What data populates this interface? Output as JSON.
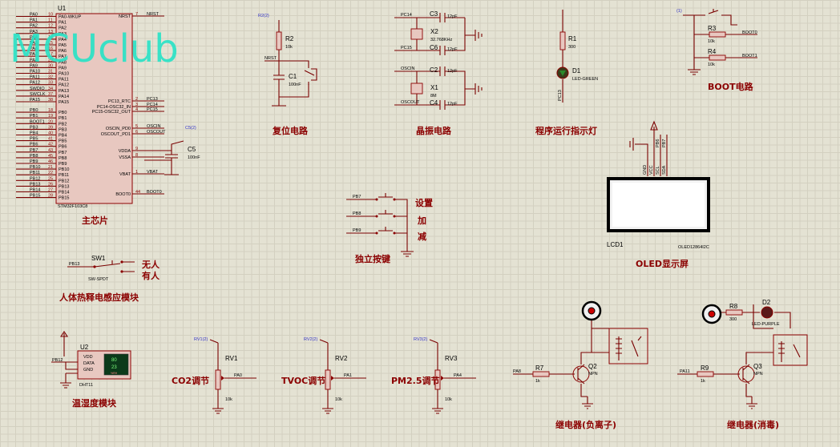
{
  "watermark": "MCUclub",
  "chip": {
    "ref": "U1",
    "part": "STM32F103C8",
    "section": "主芯片",
    "left_pins": [
      {
        "name": "PA0",
        "num": "10"
      },
      {
        "name": "PA1",
        "num": "11"
      },
      {
        "name": "PA2",
        "num": "12"
      },
      {
        "name": "PA3",
        "num": "13"
      },
      {
        "name": "PA4",
        "num": "14"
      },
      {
        "name": "PA5",
        "num": "15"
      },
      {
        "name": "PA6",
        "num": "16"
      },
      {
        "name": "PA7",
        "num": "17"
      },
      {
        "name": "PA8",
        "num": "29"
      },
      {
        "name": "PA9",
        "num": "30"
      },
      {
        "name": "PA10",
        "num": "31"
      },
      {
        "name": "PA11",
        "num": "32"
      },
      {
        "name": "PA12",
        "num": "33"
      },
      {
        "name": "SWDIO",
        "num": "34"
      },
      {
        "name": "SWCLK",
        "num": "37"
      },
      {
        "name": "PA15",
        "num": "38"
      },
      {
        "name": "PB0",
        "num": "18"
      },
      {
        "name": "PB1",
        "num": "19"
      },
      {
        "name": "BOOT1",
        "num": "20"
      },
      {
        "name": "PB3",
        "num": "39"
      },
      {
        "name": "PB4",
        "num": "40"
      },
      {
        "name": "PB5",
        "num": "41"
      },
      {
        "name": "PB6",
        "num": "42"
      },
      {
        "name": "PB7",
        "num": "43"
      },
      {
        "name": "PB8",
        "num": "45"
      },
      {
        "name": "PB9",
        "num": "46"
      },
      {
        "name": "PB10",
        "num": "21"
      },
      {
        "name": "PB11",
        "num": "22"
      },
      {
        "name": "PB12",
        "num": "25"
      },
      {
        "name": "PB13",
        "num": "26"
      },
      {
        "name": "PB14",
        "num": "27"
      },
      {
        "name": "PB15",
        "num": "28"
      }
    ],
    "inner_left": [
      "PA0-WKUP",
      "PA1",
      "PA2",
      "PA3",
      "PA4",
      "PA5",
      "PA6",
      "PA7",
      "PA8",
      "PA9",
      "PA10",
      "PA11",
      "PA12",
      "PA13",
      "PA14",
      "PA15",
      "PB0",
      "PB1",
      "PB2",
      "PB3",
      "PB4",
      "PB5",
      "PB6",
      "PB7",
      "PB8",
      "PB9",
      "PB10",
      "PB11",
      "PB12",
      "PB13",
      "PB14",
      "PB15"
    ],
    "right_pins": [
      {
        "name": "NRST",
        "num": "7",
        "net": "NRST"
      },
      {
        "name": "PC13_RTC",
        "num": "2",
        "net": "PC13"
      },
      {
        "name": "PC14-OSC32_IN",
        "num": "3",
        "net": "PC14"
      },
      {
        "name": "PC15-OSC32_OUT",
        "num": "4",
        "net": "PC15"
      },
      {
        "name": "OSCIN_PD0",
        "num": "5",
        "net": "OSCIN"
      },
      {
        "name": "OSCOUT_PD1",
        "num": "6",
        "net": "OSCOUT"
      },
      {
        "name": "VDDA",
        "num": "9",
        "net": ""
      },
      {
        "name": "VSSA",
        "num": "8",
        "net": ""
      },
      {
        "name": "VBAT",
        "num": "1",
        "net": "VBAT"
      },
      {
        "name": "BOOT0",
        "num": "44",
        "net": "BOOT0"
      }
    ],
    "c5": {
      "ref": "C5",
      "value": "100nF",
      "tag": "C5(2)"
    }
  },
  "reset": {
    "section": "复位电路",
    "r_ref": "R2",
    "r_val": "10k",
    "c_ref": "C1",
    "c_val": "100nF",
    "net": "NRST",
    "tag": "R2(2)"
  },
  "crystal": {
    "section": "晶振电路",
    "c3": "C3",
    "c6": "C6",
    "c2": "C2",
    "c4": "C4",
    "cap_val": "12pF",
    "x2": "X2",
    "x2_val": "32.768KHz",
    "x1": "X1",
    "x1_val": "8M",
    "nets": [
      "PC14",
      "PC15",
      "OSCIN",
      "OSCOUT"
    ]
  },
  "led": {
    "section": "程序运行指示灯",
    "r_ref": "R1",
    "r_val": "300",
    "d_ref": "D1",
    "d_part": "LED-GREEN",
    "net": "PC13"
  },
  "boot": {
    "section": "BOOT电路",
    "r3": "R3",
    "r4": "R4",
    "r_val": "10k",
    "net0": "BOOT0",
    "net1": "BOOT1",
    "tag": "(1)"
  },
  "lcd": {
    "section": "OLED显示屏",
    "ref": "LCD1",
    "part": "OLED12864I2C",
    "pins": [
      "GND",
      "VCC",
      "SCL",
      "SDA"
    ],
    "nets": [
      "PB6",
      "PB7"
    ]
  },
  "keys": {
    "section": "独立按键",
    "nets": [
      "PB7",
      "PB8",
      "PB9"
    ],
    "labels": [
      "设置",
      "加",
      "减"
    ]
  },
  "pir": {
    "section": "人体热释电感应模块",
    "ref": "SW1",
    "part": "SW-SPDT",
    "net": "PB13",
    "labels": [
      "无人",
      "有人"
    ]
  },
  "dht": {
    "section": "温湿度模块",
    "ref": "U2",
    "part": "DHT11",
    "net": "PB12",
    "pins": [
      "VDD",
      "DATA",
      "GND"
    ],
    "display": [
      "80",
      "23"
    ],
    "unit": "%RH"
  },
  "pots": [
    {
      "label": "CO2调节",
      "ref": "RV1",
      "val": "10k",
      "net": "PA0",
      "tag": "RV1(2)"
    },
    {
      "label": "TVOC调节",
      "ref": "RV2",
      "val": "10k",
      "net": "PA1",
      "tag": "RV2(2)"
    },
    {
      "label": "PM2.5调节",
      "ref": "RV3",
      "val": "10k",
      "net": "PA4",
      "tag": "RV3(2)"
    }
  ],
  "relay1": {
    "section": "继电器(负离子)",
    "r_ref": "R7",
    "r_val": "1k",
    "q_ref": "Q2",
    "q_part": "NPN",
    "net": "PA8"
  },
  "relay2": {
    "section": "继电器(消毒)",
    "r_ref": "R9",
    "r_val": "1k",
    "q_ref": "Q3",
    "q_part": "NPN",
    "net": "PA11",
    "r8": "R8",
    "r8_val": "300",
    "d_ref": "D2",
    "d_part": "LED-PURPLE"
  }
}
